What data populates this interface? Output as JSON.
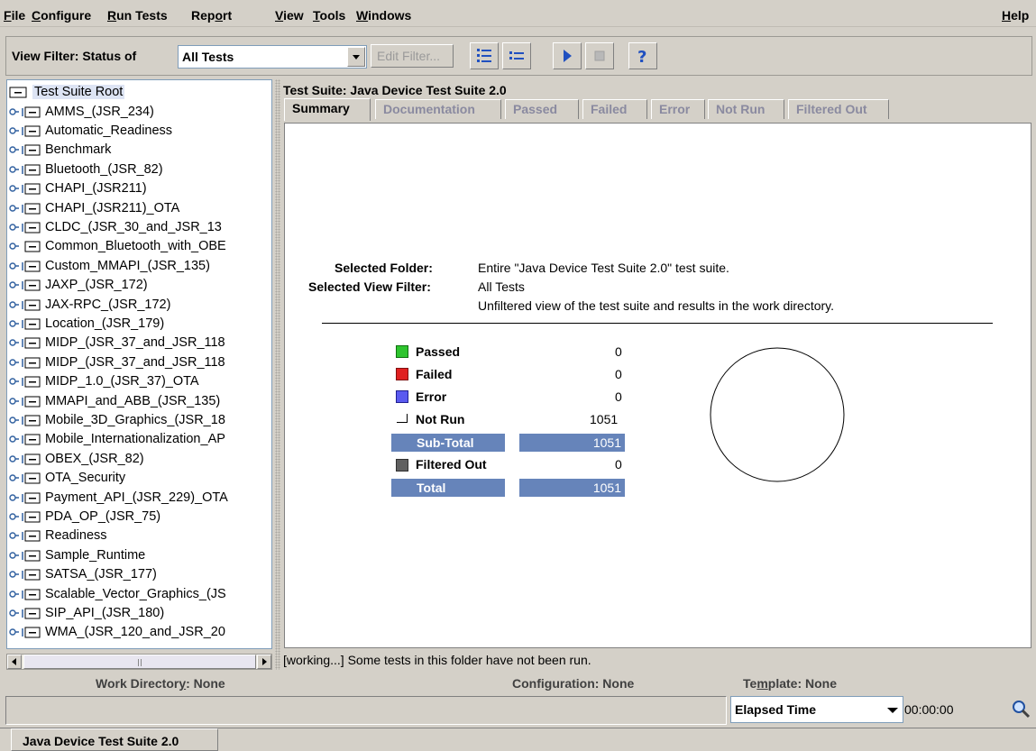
{
  "menu": [
    {
      "label": "File",
      "u": 0
    },
    {
      "label": "Configure",
      "u": 0
    },
    {
      "label": "Run Tests",
      "u": 0
    },
    {
      "label": "Report",
      "u": 3
    },
    {
      "label": "View",
      "u": 0
    },
    {
      "label": "Tools",
      "u": 0
    },
    {
      "label": "Windows",
      "u": 0
    }
  ],
  "help_label": "Help",
  "toolbar": {
    "view_filter_label": "View Filter: Status of",
    "filter_value": "All Tests",
    "edit_filter_label": "Edit Filter..."
  },
  "tree": {
    "root": "Test Suite Root",
    "items": [
      "AMMS_(JSR_234)",
      "Automatic_Readiness",
      "Benchmark",
      "Bluetooth_(JSR_82)",
      "CHAPI_(JSR211)",
      "CHAPI_(JSR211)_OTA",
      "CLDC_(JSR_30_and_JSR_13",
      "Common_Bluetooth_with_OBE",
      "Custom_MMAPI_(JSR_135)",
      "JAXP_(JSR_172)",
      "JAX-RPC_(JSR_172)",
      "Location_(JSR_179)",
      "MIDP_(JSR_37_and_JSR_118",
      "MIDP_(JSR_37_and_JSR_118",
      "MIDP_1.0_(JSR_37)_OTA",
      "MMAPI_and_ABB_(JSR_135)",
      "Mobile_3D_Graphics_(JSR_18",
      "Mobile_Internationalization_AP",
      "OBEX_(JSR_82)",
      "OTA_Security",
      "Payment_API_(JSR_229)_OTA",
      "PDA_OP_(JSR_75)",
      "Readiness",
      "Sample_Runtime",
      "SATSA_(JSR_177)",
      "Scalable_Vector_Graphics_(JS",
      "SIP_API_(JSR_180)",
      "WMA_(JSR_120_and_JSR_20"
    ]
  },
  "panel": {
    "title": "Test Suite: Java Device Test Suite 2.0",
    "tabs": [
      "Summary",
      "Documentation",
      "Passed",
      "Failed",
      "Error",
      "Not Run",
      "Filtered Out"
    ],
    "selected_folder_label": "Selected Folder:",
    "selected_folder_value": "Entire \"Java Device Test Suite 2.0\" test suite.",
    "selected_filter_label": "Selected View Filter:",
    "selected_filter_value": "All Tests",
    "selected_filter_desc": "Unfiltered view of the test suite and results in the work directory.",
    "stats": {
      "passed_label": "Passed",
      "passed": "0",
      "failed_label": "Failed",
      "failed": "0",
      "error_label": "Error",
      "error": "0",
      "notrun_label": "Not Run",
      "notrun": "1051",
      "subtotal_label": "Sub-Total",
      "subtotal": "1051",
      "filtered_label": "Filtered Out",
      "filtered": "0",
      "total_label": "Total",
      "total": "1051"
    }
  },
  "status_message": "[working...] Some tests in this folder have not been run.",
  "bottom": {
    "work_dir": "Work Directory: None",
    "configuration": "Configuration: None",
    "template": "Template: None",
    "elapsed_label": "Elapsed Time",
    "elapsed_value": "00:00:00"
  },
  "window_tab": "Java Device Test Suite 2.0",
  "colors": {
    "passed": "#2ec42e",
    "failed": "#e02020",
    "error": "#5a5af0",
    "filtered": "#606060",
    "bar": "#6684ba"
  }
}
